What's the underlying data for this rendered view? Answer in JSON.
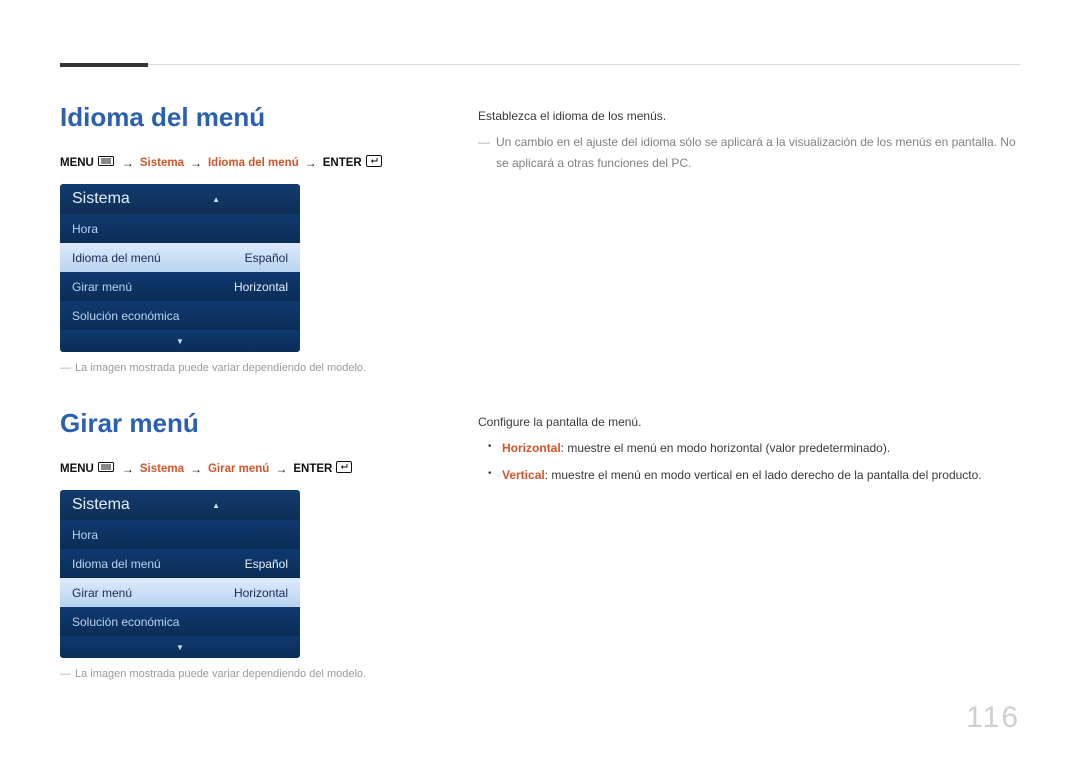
{
  "page_number": "116",
  "section1": {
    "heading": "Idioma del menú",
    "breadcrumb": {
      "menu": "MENU",
      "step1": "Sistema",
      "step2": "Idioma del menú",
      "enter": "ENTER"
    },
    "osd": {
      "title": "Sistema",
      "rows": [
        {
          "label": "Hora",
          "value": "",
          "selected": false
        },
        {
          "label": "Idioma del menú",
          "value": "Español",
          "selected": true
        },
        {
          "label": "Girar menú",
          "value": "Horizontal",
          "selected": false
        },
        {
          "label": "Solución económica",
          "value": "",
          "selected": false
        }
      ]
    },
    "note": "La imagen mostrada puede variar dependiendo del modelo."
  },
  "description1": {
    "line1": "Establezca el idioma de los menús.",
    "note": "Un cambio en el ajuste del idioma sólo se aplicará a la visualización de los menús en pantalla. No se aplicará a otras funciones del PC."
  },
  "section2": {
    "heading": "Girar menú",
    "breadcrumb": {
      "menu": "MENU",
      "step1": "Sistema",
      "step2": "Girar menú",
      "enter": "ENTER"
    },
    "osd": {
      "title": "Sistema",
      "rows": [
        {
          "label": "Hora",
          "value": "",
          "selected": false
        },
        {
          "label": "Idioma del menú",
          "value": "Español",
          "selected": false
        },
        {
          "label": "Girar menú",
          "value": "Horizontal",
          "selected": true
        },
        {
          "label": "Solución económica",
          "value": "",
          "selected": false
        }
      ]
    },
    "note": "La imagen mostrada puede variar dependiendo del modelo."
  },
  "description2": {
    "line1": "Configure la pantalla de menú.",
    "bullets": [
      {
        "term": "Horizontal",
        "text": ": muestre el menú en modo horizontal (valor predeterminado)."
      },
      {
        "term": "Vertical",
        "text": ": muestre el menú en modo vertical en el lado derecho de la pantalla del producto."
      }
    ]
  }
}
